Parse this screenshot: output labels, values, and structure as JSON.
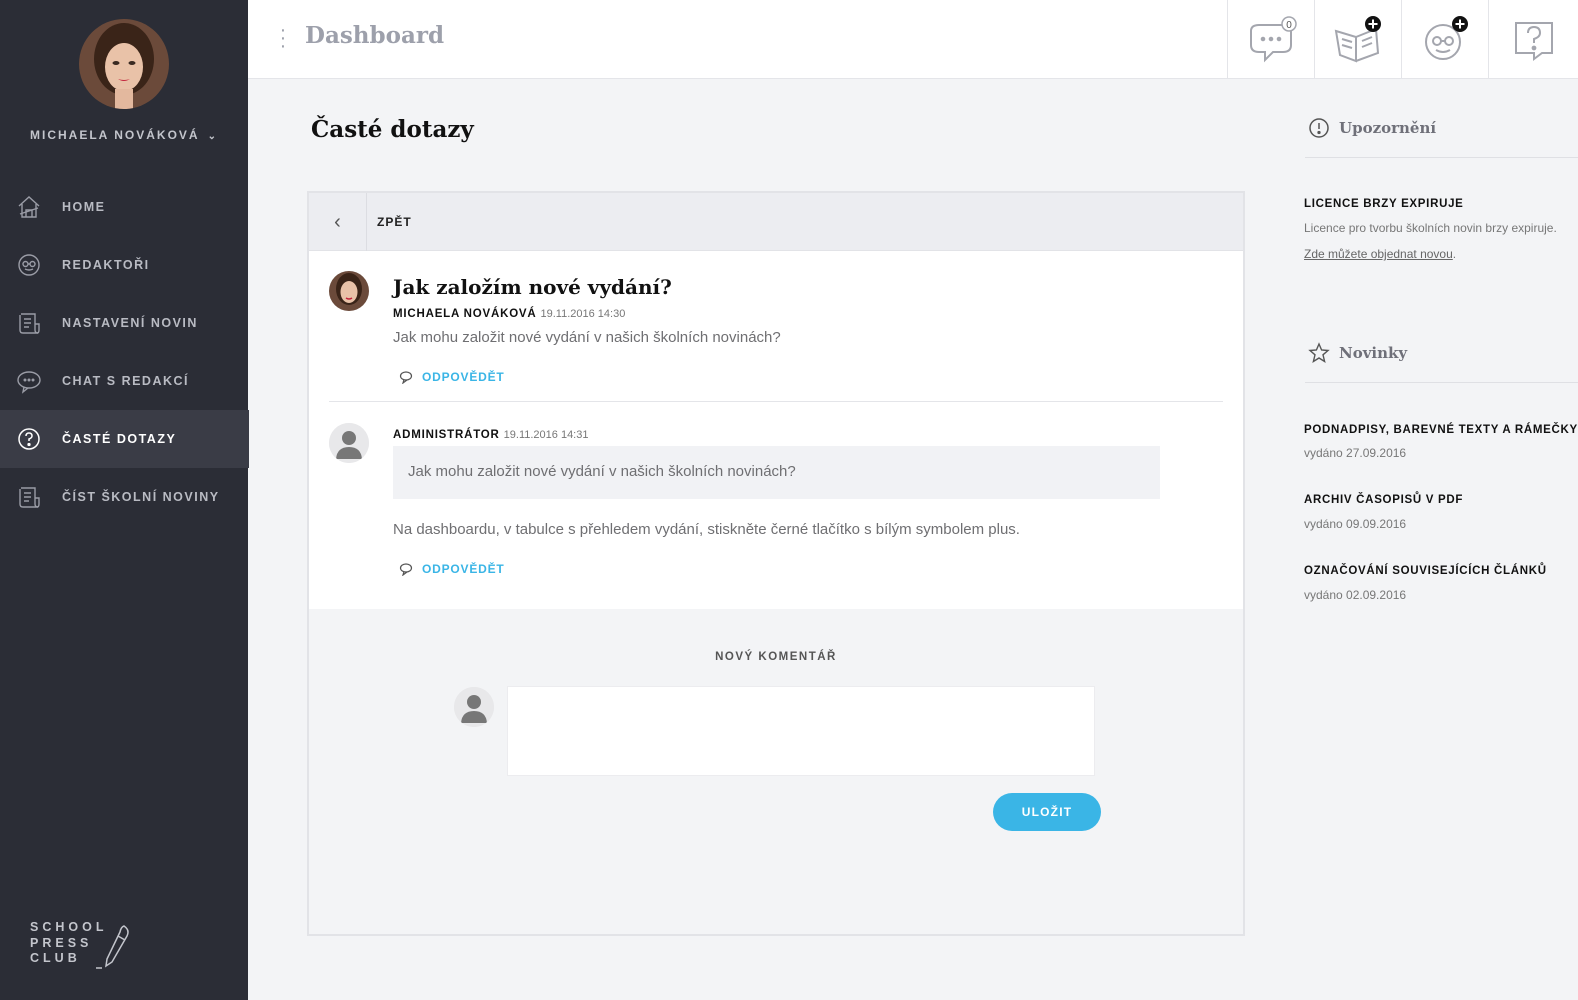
{
  "sidebar": {
    "user_name": "MICHAELA NOVÁKOVÁ",
    "items": [
      {
        "label": "HOME",
        "icon": "home-icon"
      },
      {
        "label": "REDAKTOŘI",
        "icon": "editors-icon"
      },
      {
        "label": "NASTAVENÍ NOVIN",
        "icon": "newspaper-settings-icon"
      },
      {
        "label": "CHAT S REDAKCÍ",
        "icon": "chat-icon"
      },
      {
        "label": "ČASTÉ DOTAZY",
        "icon": "question-icon",
        "active": true
      },
      {
        "label": "ČÍST ŠKOLNÍ NOVINY",
        "icon": "read-newspaper-icon"
      }
    ],
    "logo_lines": [
      "SCHOOL",
      "PRESS",
      "CLUB"
    ]
  },
  "topbar": {
    "title": "Dashboard",
    "chat_count": "0",
    "buttons": [
      "chat-icon",
      "add-issue-icon",
      "add-editor-icon",
      "help-icon"
    ]
  },
  "main": {
    "title": "Časté dotazy",
    "back_label": "ZPĚT",
    "question": {
      "title": "Jak založím nové vydání?",
      "author": "MICHAELA NOVÁKOVÁ",
      "date": "19.11.2016 14:30",
      "text": "Jak mohu založit nové vydání v našich školních novinách?",
      "reply_label": "ODPOVĚDĚT"
    },
    "answer": {
      "author": "ADMINISTRÁTOR",
      "date": "19.11.2016 14:31",
      "quote": "Jak mohu založit nové vydání v našich školních novinách?",
      "text": "Na dashboardu, v tabulce s přehledem vydání, stiskněte černé tlačítko s bílým symbolem plus.",
      "reply_label": "ODPOVĚDĚT"
    },
    "new_comment": {
      "label": "NOVÝ KOMENTÁŘ",
      "value": "",
      "save_label": "ULOŽIT"
    }
  },
  "right": {
    "alerts": {
      "title": "Upozornění",
      "heading": "LICENCE BRZY EXPIRUJE",
      "text": "Licence pro tvorbu školních novin brzy expiruje.",
      "link": "Zde můžete objednat novou",
      "link_suffix": "."
    },
    "news": {
      "title": "Novinky",
      "items": [
        {
          "title": "PODNADPISY, BAREVNÉ TEXTY A RÁMEČKY",
          "date": "vydáno 27.09.2016"
        },
        {
          "title": "ARCHIV ČASOPISŮ V PDF",
          "date": "vydáno 09.09.2016"
        },
        {
          "title": "OZNAČOVÁNÍ SOUVISEJÍCÍCH ČLÁNKŮ",
          "date": "vydáno 02.09.2016"
        }
      ]
    }
  },
  "colors": {
    "sidebar_bg": "#2b2d36",
    "accent": "#3ab5e6",
    "page_bg": "#f3f4f6"
  }
}
